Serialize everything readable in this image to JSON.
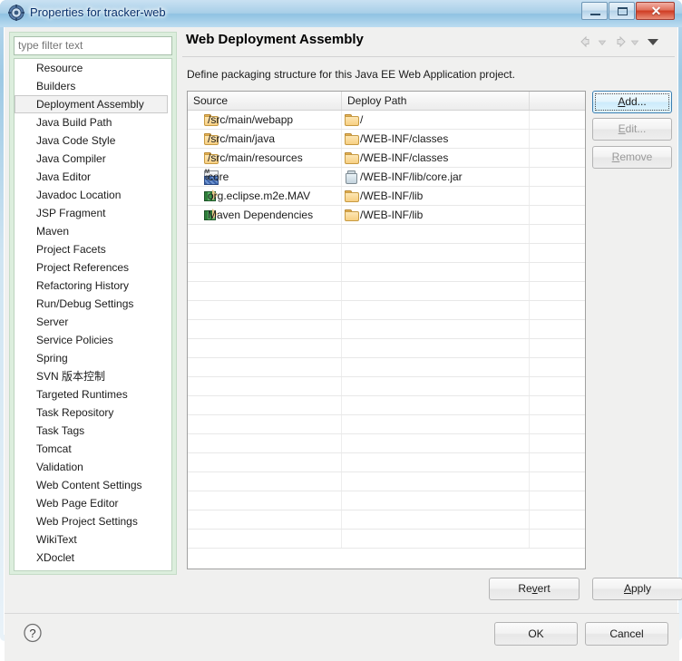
{
  "window": {
    "title": "Properties for tracker-web",
    "icon": "properties-gear-icon",
    "controls": {
      "minimize": "─",
      "maximize": "□",
      "close": "✕"
    }
  },
  "filter": {
    "placeholder": "type filter text",
    "value": ""
  },
  "sidebar": {
    "selected": "Deployment Assembly",
    "items": [
      {
        "label": "Resource"
      },
      {
        "label": "Builders"
      },
      {
        "label": "Deployment Assembly"
      },
      {
        "label": "Java Build Path"
      },
      {
        "label": "Java Code Style"
      },
      {
        "label": "Java Compiler"
      },
      {
        "label": "Java Editor"
      },
      {
        "label": "Javadoc Location"
      },
      {
        "label": "JSP Fragment"
      },
      {
        "label": "Maven"
      },
      {
        "label": "Project Facets"
      },
      {
        "label": "Project References"
      },
      {
        "label": "Refactoring History"
      },
      {
        "label": "Run/Debug Settings"
      },
      {
        "label": "Server"
      },
      {
        "label": "Service Policies"
      },
      {
        "label": "Spring"
      },
      {
        "label": "SVN 版本控制"
      },
      {
        "label": "Targeted Runtimes"
      },
      {
        "label": "Task Repository"
      },
      {
        "label": "Task Tags"
      },
      {
        "label": "Tomcat"
      },
      {
        "label": "Validation"
      },
      {
        "label": "Web Content Settings"
      },
      {
        "label": "Web Page Editor"
      },
      {
        "label": "Web Project Settings"
      },
      {
        "label": "WikiText"
      },
      {
        "label": "XDoclet"
      }
    ]
  },
  "page": {
    "title": "Web Deployment Assembly",
    "description": "Define packaging structure for this Java EE Web Application project.",
    "nav": {
      "back_icon": "arrow-left-icon",
      "back_menu_icon": "chevron-down-icon",
      "forward_icon": "arrow-right-icon",
      "forward_menu_icon": "chevron-down-icon",
      "view_menu_icon": "chevron-down-icon"
    }
  },
  "table": {
    "columns": [
      "Source",
      "Deploy Path",
      ""
    ],
    "rows": [
      {
        "source": "/src/main/webapp",
        "source_icon": "folder-icon",
        "deploy": "/",
        "deploy_icon": "folder-icon"
      },
      {
        "source": "/src/main/java",
        "source_icon": "folder-icon",
        "deploy": "/WEB-INF/classes",
        "deploy_icon": "folder-icon"
      },
      {
        "source": "/src/main/resources",
        "source_icon": "folder-icon",
        "deploy": "/WEB-INF/classes",
        "deploy_icon": "folder-icon"
      },
      {
        "source": "core",
        "source_icon": "project-icon",
        "deploy": "/WEB-INF/lib/core.jar",
        "deploy_icon": "jar-icon"
      },
      {
        "source": "org.eclipse.m2e.MAV",
        "source_icon": "library-icon",
        "deploy": "/WEB-INF/lib",
        "deploy_icon": "folder-icon"
      },
      {
        "source": "Maven Dependencies",
        "source_icon": "library-icon",
        "deploy": "/WEB-INF/lib",
        "deploy_icon": "folder-icon"
      }
    ],
    "empty_row_count": 17
  },
  "side_buttons": {
    "add": {
      "label": "Add...",
      "mnemonic": "A",
      "enabled": true,
      "focused": true
    },
    "edit": {
      "label": "Edit...",
      "mnemonic": "E",
      "enabled": false,
      "focused": false
    },
    "remove": {
      "label": "Remove",
      "mnemonic": "R",
      "enabled": false,
      "focused": false
    }
  },
  "page_buttons": {
    "revert": {
      "label": "Revert",
      "mnemonic": "v"
    },
    "apply": {
      "label": "Apply",
      "mnemonic": "A"
    }
  },
  "dialog_buttons": {
    "help_icon": "help-question-icon",
    "ok": "OK",
    "cancel": "Cancel"
  },
  "colors": {
    "accent": "#3c7fb1",
    "titlebar": "#8fc2e2",
    "close_button": "#cf3b22",
    "filter_panel": "#dceedd",
    "folder": "#f7cf82"
  }
}
